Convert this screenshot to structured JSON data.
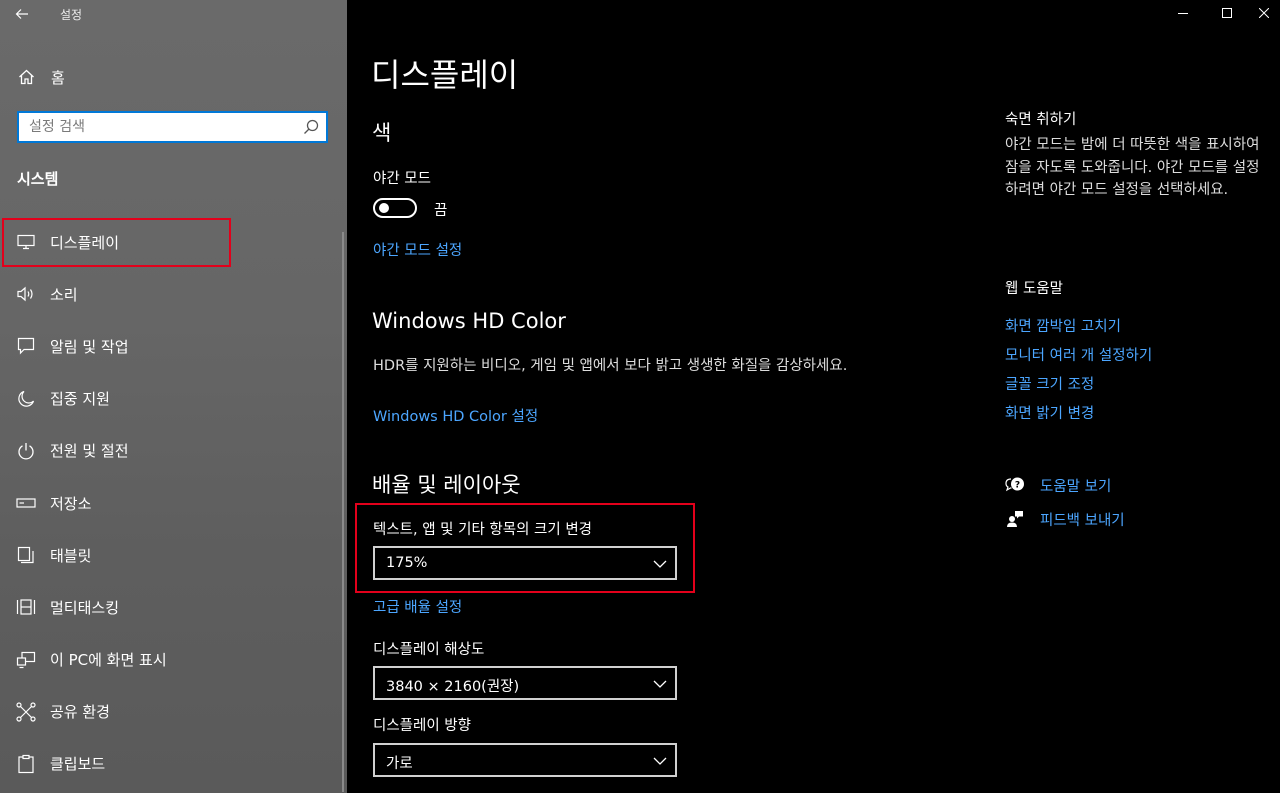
{
  "window": {
    "title": "설정",
    "back_icon": "arrow-left-icon",
    "minimize_icon": "minimize-icon",
    "maximize_icon": "maximize-icon",
    "close_icon": "close-icon"
  },
  "sidebar": {
    "home_label": "홈",
    "search_placeholder": "설정 검색",
    "section_title": "시스템",
    "items": [
      {
        "label": "디스플레이",
        "icon": "monitor-icon",
        "selected": true
      },
      {
        "label": "소리",
        "icon": "speaker-icon"
      },
      {
        "label": "알림 및 작업",
        "icon": "notification-icon"
      },
      {
        "label": "집중 지원",
        "icon": "moon-icon"
      },
      {
        "label": "전원 및 절전",
        "icon": "power-icon"
      },
      {
        "label": "저장소",
        "icon": "storage-icon"
      },
      {
        "label": "태블릿",
        "icon": "tablet-icon"
      },
      {
        "label": "멀티태스킹",
        "icon": "multitasking-icon"
      },
      {
        "label": "이 PC에 화면 표시",
        "icon": "project-icon"
      },
      {
        "label": "공유 환경",
        "icon": "shared-experiences-icon"
      },
      {
        "label": "클립보드",
        "icon": "clipboard-icon"
      }
    ]
  },
  "main": {
    "page_title": "디스플레이",
    "color": {
      "heading": "색",
      "night_light_label": "야간 모드",
      "night_light_state": "끔",
      "night_light_settings_link": "야간 모드 설정"
    },
    "hdr": {
      "heading": "Windows HD Color",
      "description": "HDR를 지원하는 비디오, 게임 및 앱에서 보다 밝고 생생한 화질을 감상하세요.",
      "settings_link": "Windows HD Color 설정"
    },
    "scale_layout": {
      "heading": "배율 및 레이아웃",
      "scale_label": "텍스트, 앱 및 기타 항목의 크기 변경",
      "scale_value": "175%",
      "advanced_scaling_link": "고급 배율 설정",
      "resolution_label": "디스플레이 해상도",
      "resolution_value": "3840 × 2160(권장)",
      "orientation_label": "디스플레이 방향",
      "orientation_value": "가로"
    }
  },
  "right": {
    "sleep": {
      "heading": "숙면 취하기",
      "description": "야간 모드는 밤에 더 따뜻한 색을 표시하여 잠을 자도록 도와줍니다. 야간 모드를 설정하려면 야간 모드 설정을 선택하세요."
    },
    "web_help": {
      "heading": "웹 도움말",
      "links": [
        "화면 깜박임 고치기",
        "모니터 여러 개 설정하기",
        "글꼴 크기 조정",
        "화면 밝기 변경"
      ]
    },
    "get_help": "도움말 보기",
    "feedback": "피드백 보내기"
  },
  "colors": {
    "accent": "#0078d7",
    "link": "#4ca6ff",
    "highlight": "#e3001b"
  }
}
